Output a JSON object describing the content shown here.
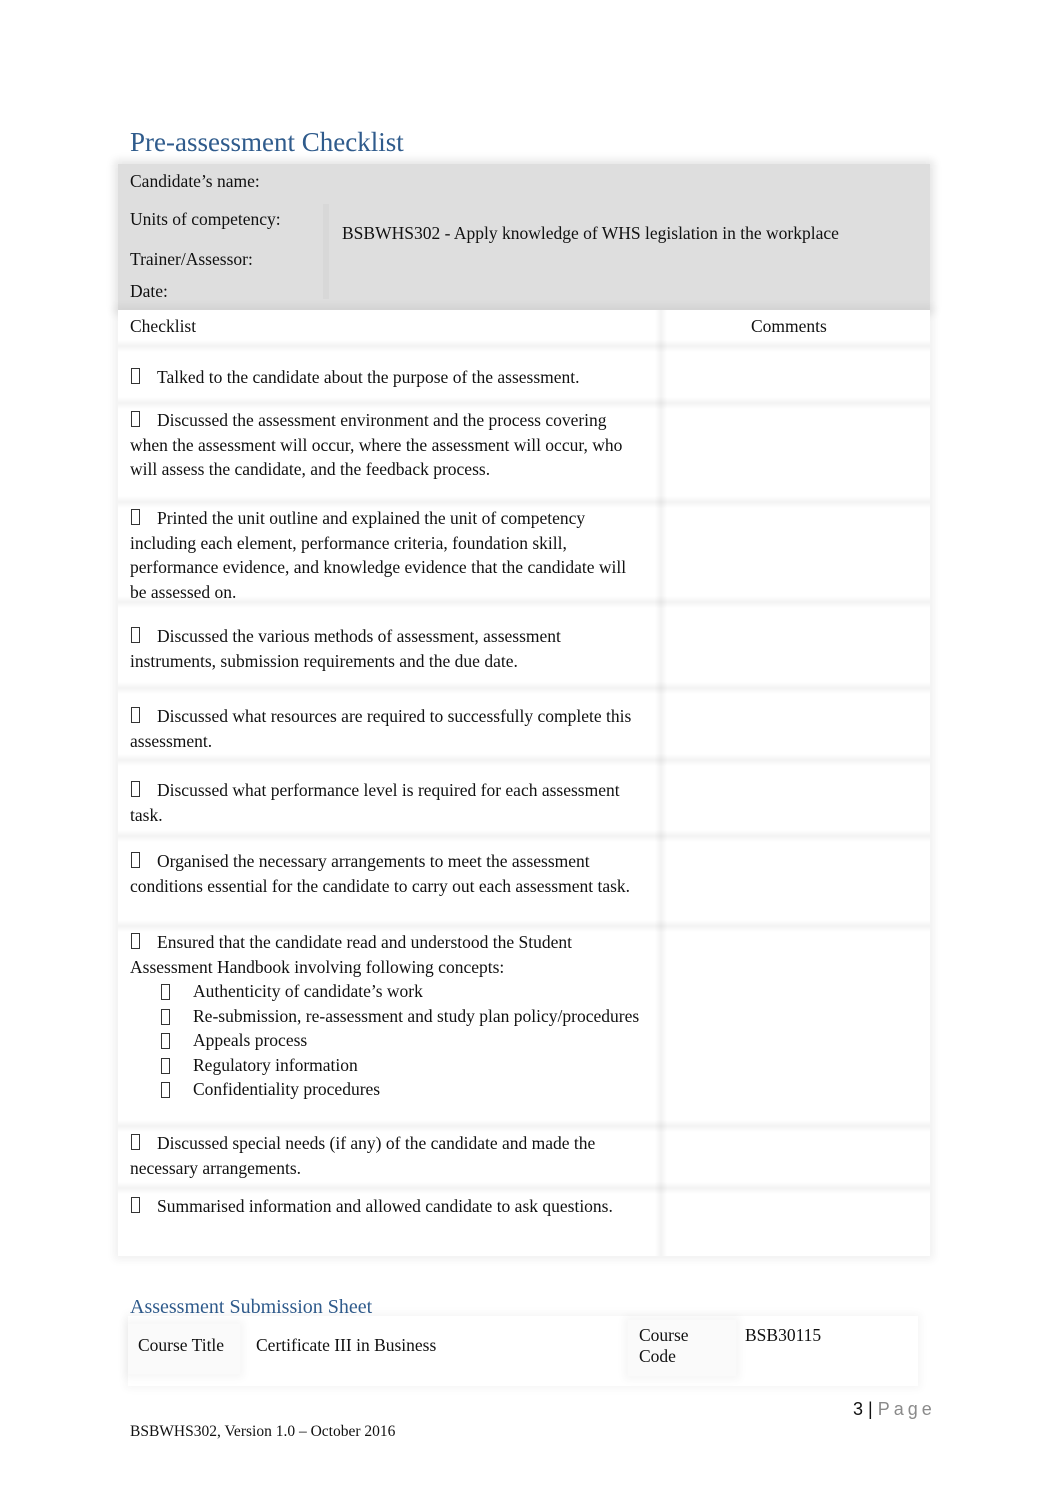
{
  "document": {
    "title": "Pre-assessment Checklist",
    "header": {
      "candidate_label": "Candidate’s name:",
      "units_label": "Units of competency:",
      "units_value": "BSBWHS302 - Apply knowledge of WHS legislation in the workplace",
      "trainer_label": "Trainer/Assessor:",
      "date_label": "Date:"
    },
    "checklist": {
      "col_checklist": "Checklist",
      "col_comments": "Comments",
      "items": [
        {
          "text": "Talked to the candidate about the purpose of the assessment."
        },
        {
          "text": "Discussed the assessment environment and the process covering when the assessment will occur, where the assessment will occur, who will assess the candidate, and the feedback process."
        },
        {
          "text": "Printed the unit outline and explained the unit of competency including each element, performance criteria, foundation skill, performance evidence, and knowledge evidence that the candidate will be assessed on."
        },
        {
          "text": "Discussed the various methods of assessment, assessment instruments, submission requirements and the due date."
        },
        {
          "text": "Discussed what resources are required to successfully complete this assessment."
        },
        {
          "text": "Discussed what performance level is required for each assessment task."
        },
        {
          "text": "Organised the necessary arrangements to meet the assessment conditions essential for the candidate to carry out each assessment task."
        },
        {
          "text": "Ensured that the candidate read and understood the Student Assessment Handbook involving following concepts:",
          "subitems": [
            "Authenticity of candidate’s work",
            "Re-submission, re-assessment and study plan policy/procedures",
            "Appeals process",
            "Regulatory information",
            "Confidentiality procedures"
          ]
        },
        {
          "text": "Discussed special needs (if any) of the candidate and made the necessary arrangements."
        },
        {
          "text": "Summarised information and allowed candidate to ask questions."
        }
      ]
    },
    "submission": {
      "title": "Assessment Submission Sheet",
      "course_title_label": "Course Title",
      "course_title_value": "Certificate III in Business",
      "course_code_label": "Course Code",
      "course_code_value": "BSB30115"
    },
    "page": {
      "number": "3",
      "separator": "|",
      "word": "Page"
    },
    "footer": "BSBWHS302, Version 1.0 – October 2016"
  }
}
